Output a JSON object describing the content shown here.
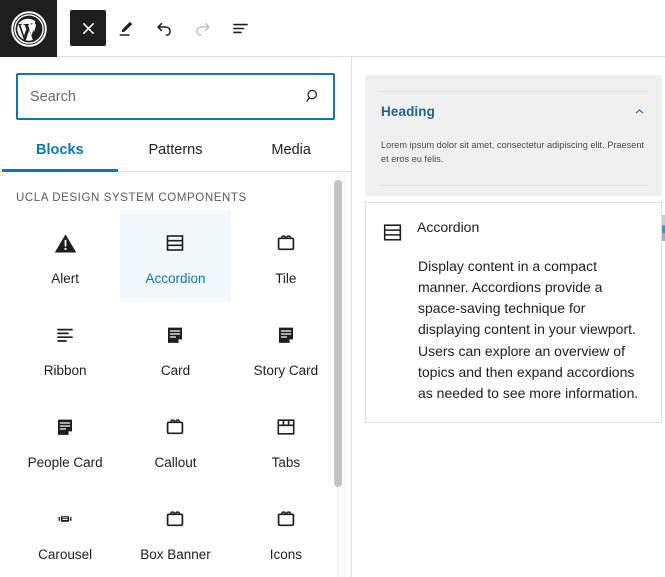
{
  "toolbar": {
    "logo": "wordpress-logo",
    "buttons": [
      {
        "name": "close-inserter-button",
        "icon": "close-icon",
        "label": "Close block inserter",
        "state": "active"
      },
      {
        "name": "edit-mode-button",
        "icon": "pencil-icon",
        "label": "Edit",
        "state": "enabled"
      },
      {
        "name": "undo-button",
        "icon": "undo-icon",
        "label": "Undo",
        "state": "enabled"
      },
      {
        "name": "redo-button",
        "icon": "redo-icon",
        "label": "Redo",
        "state": "disabled"
      },
      {
        "name": "list-view-button",
        "icon": "list-view-icon",
        "label": "Document overview",
        "state": "enabled"
      }
    ]
  },
  "inserter": {
    "search": {
      "placeholder": "Search",
      "value": "",
      "icon": "search-icon"
    },
    "tabs": [
      {
        "label": "Blocks",
        "active": true
      },
      {
        "label": "Patterns",
        "active": false
      },
      {
        "label": "Media",
        "active": false
      }
    ],
    "section_title": "UCLA DESIGN SYSTEM COMPONENTS",
    "blocks": [
      {
        "label": "Alert",
        "icon": "alert-triangle-icon",
        "selected": false
      },
      {
        "label": "Accordion",
        "icon": "accordion-icon",
        "selected": true
      },
      {
        "label": "Tile",
        "icon": "tile-icon",
        "selected": false
      },
      {
        "label": "Ribbon",
        "icon": "ribbon-lines-icon",
        "selected": false
      },
      {
        "label": "Card",
        "icon": "card-document-icon",
        "selected": false
      },
      {
        "label": "Story Card",
        "icon": "card-document-icon",
        "selected": false
      },
      {
        "label": "People Card",
        "icon": "card-document-icon",
        "selected": false
      },
      {
        "label": "Callout",
        "icon": "tile-icon",
        "selected": false
      },
      {
        "label": "Tabs",
        "icon": "tabs-grid-icon",
        "selected": false
      },
      {
        "label": "Carousel",
        "icon": "carousel-icon",
        "selected": false
      },
      {
        "label": "Box Banner",
        "icon": "tile-icon",
        "selected": false
      },
      {
        "label": "Icons",
        "icon": "tile-icon",
        "selected": false
      }
    ],
    "scrollbar": {
      "name": "block-list-scrollbar"
    }
  },
  "preview": {
    "accordion": {
      "heading": "Heading",
      "chevron": "chevron-up-icon",
      "body": "Lorem ipsum dolor sit amet, consectetur adipiscing elit. Praesent et eros eu felis."
    },
    "description_card": {
      "icon": "accordion-icon",
      "title": "Accordion",
      "text": "Display content in a compact manner. Accordions provide a space-saving technique for displaying content in your viewport. Users can explore an overview of topics and then expand accordions as needed to see more information."
    }
  },
  "colors": {
    "wp_admin_dark": "#1e1e1e",
    "accent_blue": "#0b76b8",
    "ucla_blue": "#1a6496",
    "selected_cell_bg": "#f2f9fb",
    "preview_bg": "#f0f0f0",
    "border_gray": "#e0e0e0"
  }
}
